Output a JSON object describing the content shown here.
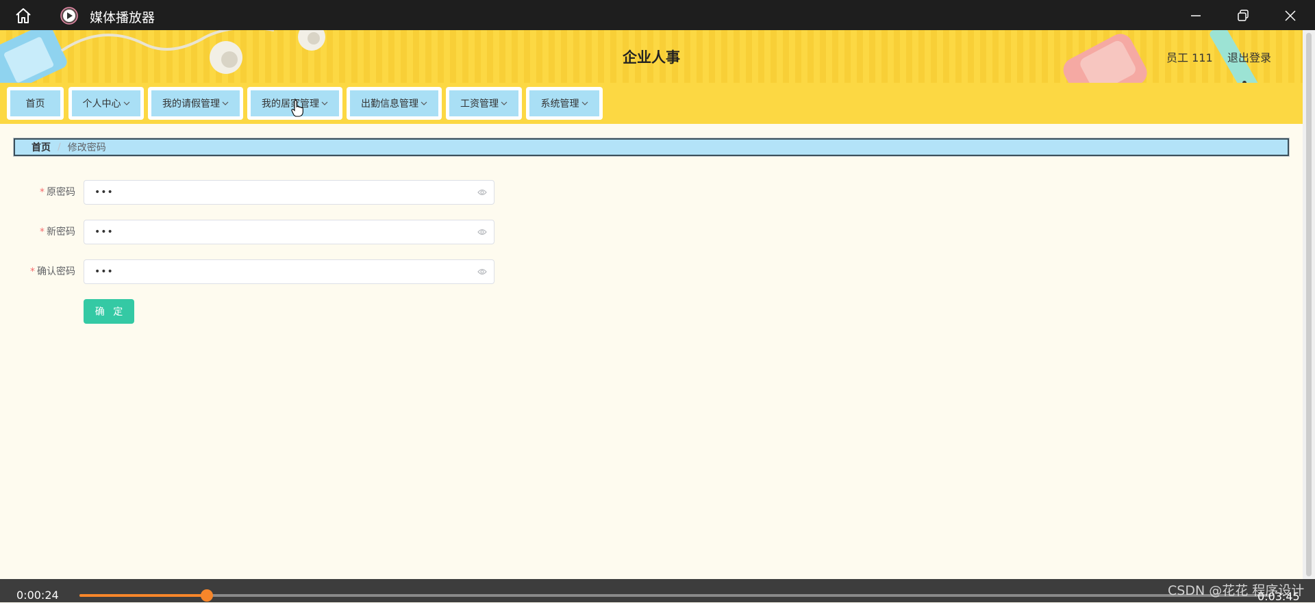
{
  "player": {
    "app_title": "媒体播放器",
    "icons": [
      "home-icon",
      "media-player-icon",
      "minimize-icon",
      "restore-icon",
      "close-icon"
    ],
    "current_time": "0:00:24",
    "total_time": "0:03:45",
    "progress": 0.107,
    "accent_color": "#f7862a"
  },
  "header": {
    "site_title": "企业人事",
    "user_label": "员工 111",
    "logout_label": "退出登录",
    "background_color": "#fcd843"
  },
  "nav": {
    "items": [
      {
        "label": "首页",
        "has_dropdown": false
      },
      {
        "label": "个人中心",
        "has_dropdown": true
      },
      {
        "label": "我的请假管理",
        "has_dropdown": true
      },
      {
        "label": "我的居家管理",
        "has_dropdown": true
      },
      {
        "label": "出勤信息管理",
        "has_dropdown": true
      },
      {
        "label": "工资管理",
        "has_dropdown": true
      },
      {
        "label": "系统管理",
        "has_dropdown": true
      }
    ],
    "item_color": "#a9dff5"
  },
  "breadcrumb": {
    "home": "首页",
    "separator": "/",
    "current": "修改密码"
  },
  "form": {
    "fields": [
      {
        "label": "原密码",
        "required": true,
        "value_masked": "•••"
      },
      {
        "label": "新密码",
        "required": true,
        "value_masked": "•••"
      },
      {
        "label": "确认密码",
        "required": true,
        "value_masked": "•••"
      }
    ],
    "submit_label": "确 定",
    "submit_color": "#34c9a4"
  },
  "watermark": "CSDN @花花 程序设计"
}
